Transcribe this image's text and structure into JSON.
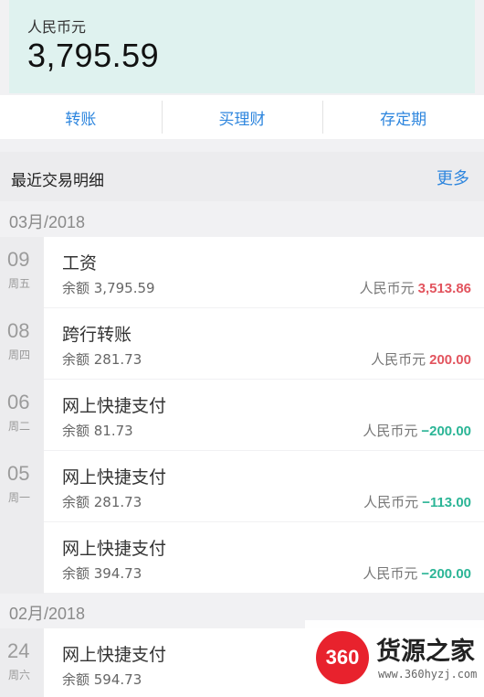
{
  "account": {
    "currency": "人民币元",
    "balance": "3,795.59"
  },
  "actions": [
    "转账",
    "买理财",
    "存定期"
  ],
  "recent": {
    "title": "最近交易明细",
    "more": "更多"
  },
  "months": [
    "03月/2018",
    "02月/2018"
  ],
  "transactions": [
    {
      "day": "09",
      "weekday": "周五",
      "title": "工资",
      "balance": "余额 3,795.59",
      "currency": "人民币元",
      "amount": "3,513.86",
      "kind": "positive"
    },
    {
      "day": "08",
      "weekday": "周四",
      "title": "跨行转账",
      "balance": "余额 281.73",
      "currency": "人民币元",
      "amount": "200.00",
      "kind": "positive"
    },
    {
      "day": "06",
      "weekday": "周二",
      "title": "网上快捷支付",
      "balance": "余额 81.73",
      "currency": "人民币元",
      "amount": "−200.00",
      "kind": "negative"
    },
    {
      "day": "05",
      "weekday": "周一",
      "title": "网上快捷支付",
      "balance": "余额 281.73",
      "currency": "人民币元",
      "amount": "−113.00",
      "kind": "negative"
    },
    {
      "day": "",
      "weekday": "",
      "title": "网上快捷支付",
      "balance": "余额 394.73",
      "currency": "人民币元",
      "amount": "−200.00",
      "kind": "negative"
    },
    {
      "day": "24",
      "weekday": "周六",
      "title": "网上快捷支付",
      "balance": "余额 594.73",
      "currency": "",
      "amount": "",
      "kind": "negative"
    }
  ],
  "watermark": {
    "logo": "360",
    "name": "货源之家",
    "url": "www.360hyzj.com"
  },
  "colors": {
    "accent": "#2e86de",
    "income": "#e2545e",
    "expense": "#2bb596",
    "header_bg": "#dff2ef"
  }
}
